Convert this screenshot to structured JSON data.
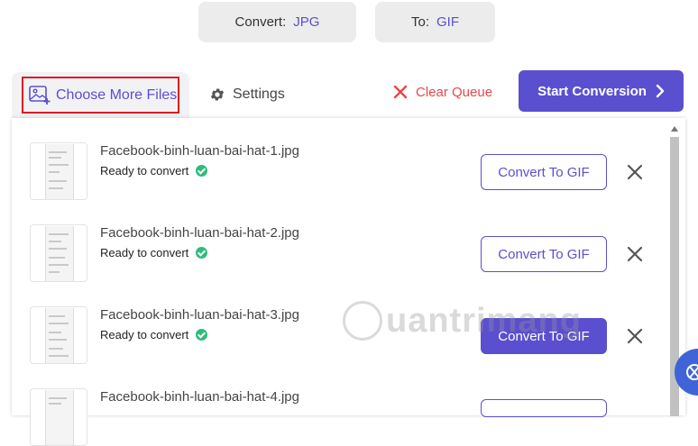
{
  "top": {
    "from_label": "Convert:",
    "from_value": "JPG",
    "to_label": "To:",
    "to_value": "GIF"
  },
  "toolbar": {
    "choose_label": "Choose More Files",
    "settings_label": "Settings",
    "clear_label": "Clear Queue",
    "start_label": "Start Conversion"
  },
  "files": [
    {
      "name": "Facebook-binh-luan-bai-hat-1.jpg",
      "status": "Ready to convert",
      "action": "Convert To GIF"
    },
    {
      "name": "Facebook-binh-luan-bai-hat-2.jpg",
      "status": "Ready to convert",
      "action": "Convert To GIF"
    },
    {
      "name": "Facebook-binh-luan-bai-hat-3.jpg",
      "status": "Ready to convert",
      "action": "Convert To GIF"
    },
    {
      "name": "Facebook-binh-luan-bai-hat-4.jpg",
      "status": "",
      "action": ""
    }
  ],
  "watermark": {
    "text": "uantrimang"
  },
  "colors": {
    "accent": "#5a4fcf",
    "danger": "#e8474a",
    "highlight_border": "#e0181f",
    "success": "#2ebc7a"
  },
  "icons": [
    "image-add-icon",
    "gear-icon",
    "close-icon",
    "chevron-right-icon",
    "check-circle-icon"
  ]
}
